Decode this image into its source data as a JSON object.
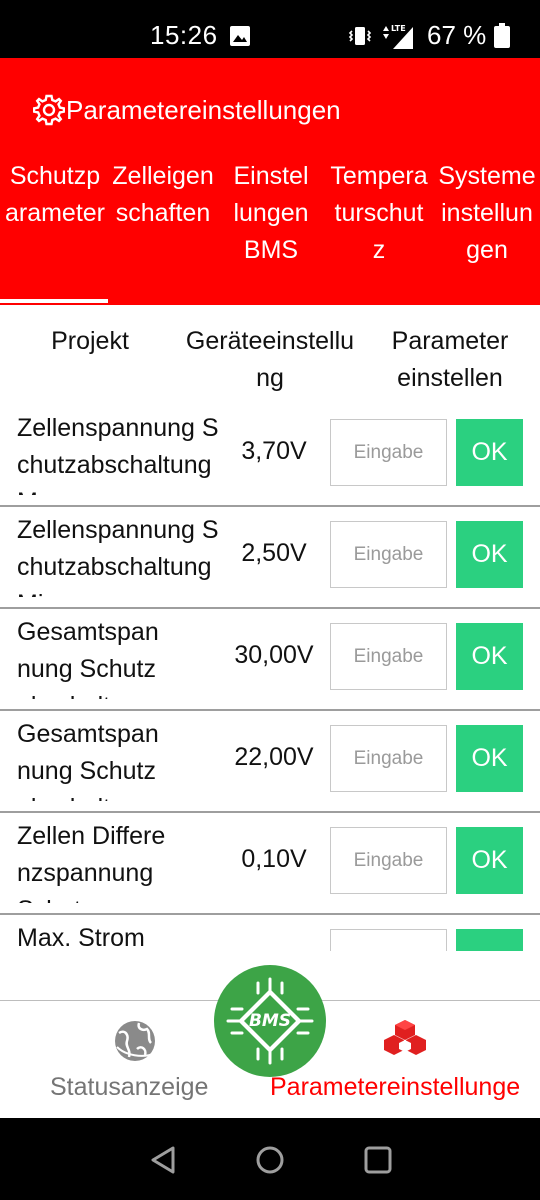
{
  "status_bar": {
    "time": "15:26",
    "battery": "67 %",
    "icons": [
      "image-icon",
      "vibrate-icon",
      "lte-signal-icon",
      "battery-icon"
    ]
  },
  "header": {
    "title": "Parametereinstellungen",
    "icon": "gear-icon",
    "tabs": [
      {
        "label": "Schutzp\narameter",
        "selected": true
      },
      {
        "label": "Zelleigen\nschaften"
      },
      {
        "label": "Einstel\nlungen\nBMS"
      },
      {
        "label": "Tempera\nturschut\nz"
      },
      {
        "label": "Systeme\ninstellun\ngen"
      }
    ]
  },
  "table": {
    "headers": [
      "Projekt",
      "Geräteeinstellu\nng",
      "Parameter\neinstellen"
    ],
    "input_placeholder": "Eingabe",
    "ok_label": "OK",
    "rows": [
      {
        "name": "Zellenspannung S\nchutzabschaltung\nMax",
        "value": "3,70V"
      },
      {
        "name": "Zellenspannung S\nchutzabschaltung\nMin",
        "value": "2,50V"
      },
      {
        "name": "Gesamtspan\nnung Schutz\nabschaltung",
        "value": "30,00V"
      },
      {
        "name": "Gesamtspan\nnung Schutz\nabschaltung",
        "value": "22,00V"
      },
      {
        "name": "Zellen Differe\nnzspannung\nSchutz",
        "value": "0,10V"
      },
      {
        "name": "Max. Strom\nLaden",
        "value": ""
      }
    ]
  },
  "bottom_nav": {
    "items": [
      {
        "label": "Statusanzeige",
        "icon": "globe-icon",
        "active": false
      },
      {
        "label": "Parametereinstellunge",
        "icon": "cubes-icon",
        "active": true
      }
    ],
    "fab_label": "BMS"
  },
  "colors": {
    "primary": "#ff0000",
    "ok_button": "#2bd080",
    "fab": "#3da447",
    "inactive_label": "#757575"
  }
}
